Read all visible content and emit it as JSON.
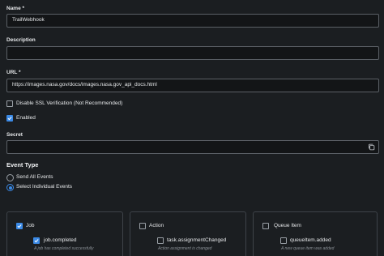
{
  "form": {
    "name": {
      "label": "Name *",
      "value": "TrailWebhook"
    },
    "description": {
      "label": "Description",
      "value": ""
    },
    "url": {
      "label": "URL *",
      "value": "https://images.nasa.gov/docs/images.nasa.gov_api_docs.html"
    },
    "disable_ssl": {
      "label": "Disable SSL Verification (Not Recommended)",
      "checked": false
    },
    "enabled": {
      "label": "Enabled",
      "checked": true
    },
    "secret": {
      "label": "Secret",
      "value": ""
    }
  },
  "event_type": {
    "heading": "Event Type",
    "options": [
      {
        "label": "Send All Events",
        "selected": false
      },
      {
        "label": "Select Individual Events",
        "selected": true
      }
    ]
  },
  "event_groups": [
    {
      "label": "Job",
      "checked": true,
      "events": [
        {
          "label": "job.completed",
          "checked": true,
          "description": "A job has completed successfully"
        }
      ]
    },
    {
      "label": "Action",
      "checked": false,
      "events": [
        {
          "label": "task.assignmentChanged",
          "checked": false,
          "description": "Action assignment is changed"
        }
      ]
    },
    {
      "label": "Queue Item",
      "checked": false,
      "events": [
        {
          "label": "queueItem.added",
          "checked": false,
          "description": "A new queue item was added"
        }
      ]
    }
  ],
  "colors": {
    "background": "#1b1e21",
    "input_background": "#131517",
    "accent": "#3b8ae6",
    "border": "#5b6066"
  },
  "icons": {
    "secret_field": "copy-icon",
    "checkmark": "check-icon"
  }
}
